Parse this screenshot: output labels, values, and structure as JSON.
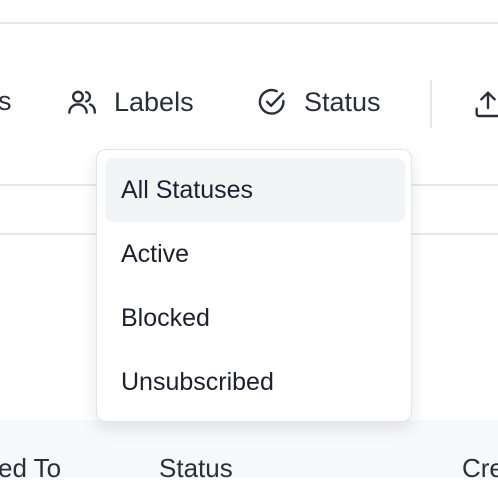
{
  "toolbar": {
    "left_partial_label": "s",
    "labels_label": "Labels",
    "status_label": "Status",
    "upload_icon": "upload-icon"
  },
  "status_dropdown": {
    "options": [
      {
        "label": "All Statuses",
        "selected": true
      },
      {
        "label": "Active",
        "selected": false
      },
      {
        "label": "Blocked",
        "selected": false
      },
      {
        "label": "Unsubscribed",
        "selected": false
      }
    ]
  },
  "table": {
    "headers": [
      "ed To",
      "Status",
      "Cre"
    ]
  }
}
